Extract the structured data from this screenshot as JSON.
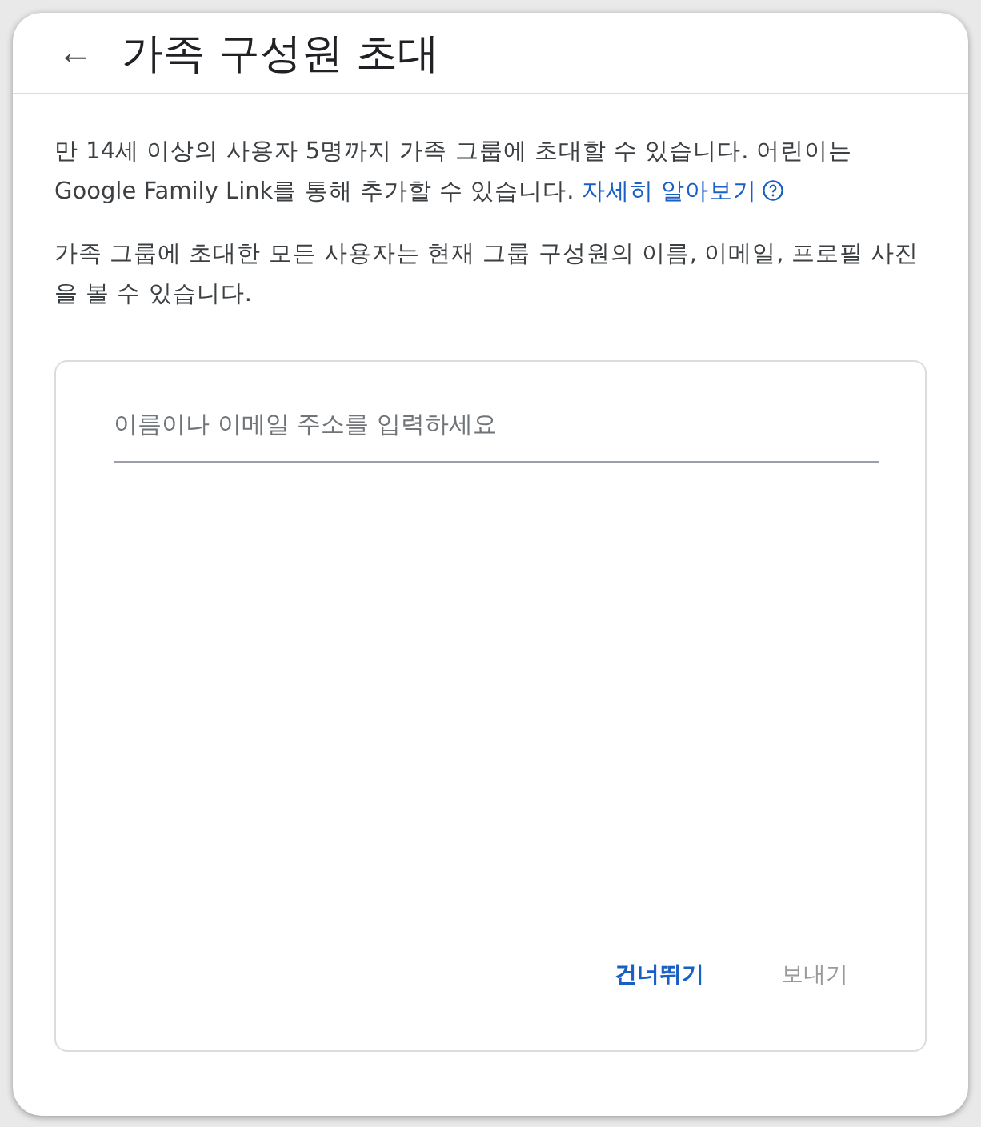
{
  "header": {
    "back_icon": "←",
    "title": "가족 구성원 초대"
  },
  "intro": {
    "text": "만 14세 이상의 사용자 5명까지 가족 그룹에 초대할 수 있습니다. 어린이는 Google Family Link를 통해 추가할 수 있습니다.",
    "link": "자세히 알아보기"
  },
  "notice": "가족 그룹에 초대한 모든 사용자는 현재 그룹 구성원의 이름, 이메일, 프로필 사진을 볼 수 있습니다.",
  "invite_field": {
    "placeholder": "이름이나 이메일 주소를 입력하세요"
  },
  "buttons": [
    {
      "label": "건너뛰기",
      "disabled": false
    },
    {
      "label": "보내기",
      "disabled": true
    }
  ]
}
